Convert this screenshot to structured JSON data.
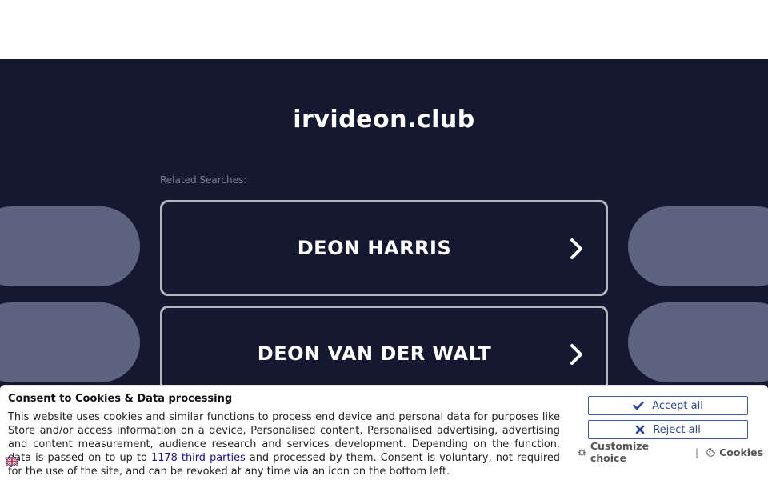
{
  "page": {
    "domain": "irvideon.club",
    "related_label": "Related Searches:"
  },
  "searches": [
    {
      "label": "DEON HARRIS"
    },
    {
      "label": "DEON VAN DER WALT"
    }
  ],
  "consent": {
    "title": "Consent to Cookies & Data processing",
    "text_before_link": "This website uses cookies and similar functions to process end device and personal data for purposes like Store and/or access information on a device, Personalised content, Personalised advertising, advertising and content measurement, audience research and services development. Depending on the function, data is passed on to up to ",
    "link_text": "1178 third parties",
    "text_after_link": " and processed by them. Consent is voluntary, not required for the use of the site, and can be revoked at any time via an icon on the bottom left.",
    "accept_label": "Accept all",
    "reject_label": "Reject all",
    "customize_label": "Customize choice",
    "separator": "|",
    "cookies_label": "Cookies"
  },
  "colors": {
    "background": "#141830",
    "pill": "#5d647f",
    "button_border": "#3a5bb8",
    "link": "#1a0dab"
  },
  "icons": {
    "chevron": "chevron-right-icon",
    "accept": "check-icon",
    "reject": "x-icon",
    "customize": "gear-icon",
    "cookies": "cookie-icon",
    "language": "flag-icon"
  }
}
